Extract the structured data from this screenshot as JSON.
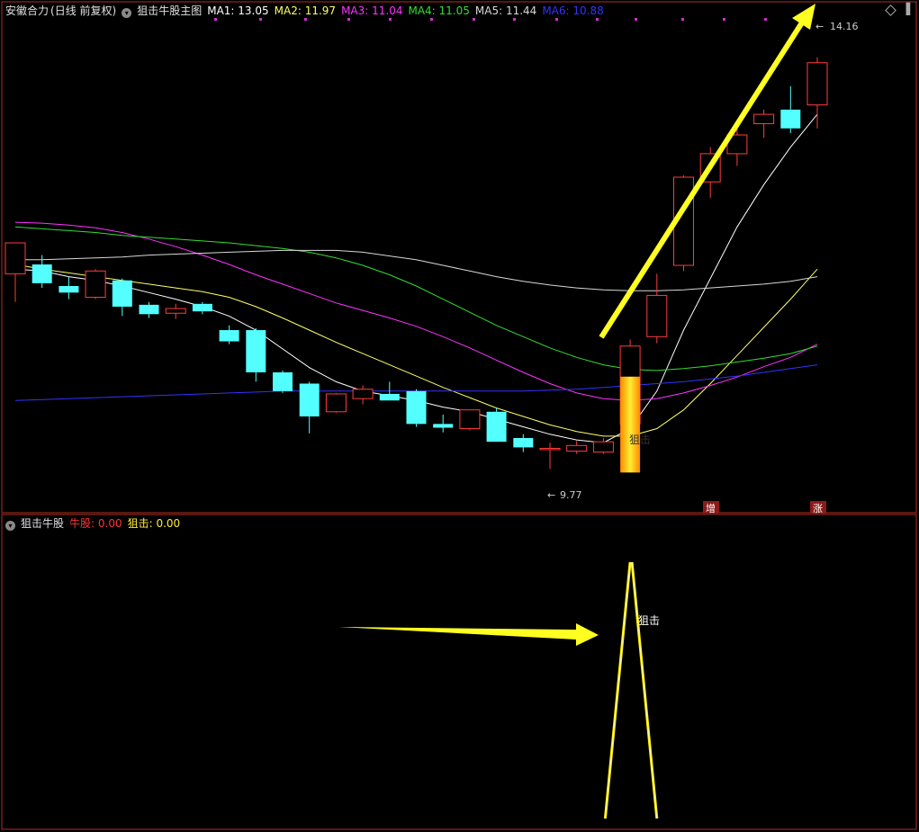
{
  "colors": {
    "background": "#000000",
    "frame": "#c0392b",
    "up_candle": "#ff3c3c",
    "down_candle": "#54ffff",
    "ma1": "#ffffff",
    "ma2": "#ffff66",
    "ma3": "#ff33ff",
    "ma4": "#33dd33",
    "ma5": "#d8d8d8",
    "ma6": "#3333ff",
    "signal": "#ffee00",
    "arrow": "#ffff22",
    "marker": "#cc33cc"
  },
  "header": {
    "stock_name": "安徽合力",
    "period": "(日线 前复权)",
    "indicator_name": "狙击牛股主图",
    "ma_labels": [
      {
        "label": "MA1: 13.05",
        "color_key": "ma1"
      },
      {
        "label": "MA2: 11.97",
        "color_key": "ma2"
      },
      {
        "label": "MA3: 11.04",
        "color_key": "ma3"
      },
      {
        "label": "MA4: 11.05",
        "color_key": "ma4"
      },
      {
        "label": "MA5: 11.44",
        "color_key": "ma5"
      },
      {
        "label": "MA6: 10.88",
        "color_key": "ma6"
      }
    ]
  },
  "sub_header": {
    "indicator_name": "狙击牛股",
    "niugu_label": "牛股: 0.00",
    "juji_label": "狙击: 0.00"
  },
  "annotations": {
    "high_label": "14.16",
    "low_label": "9.77",
    "signal_text_main": "狙击",
    "signal_text_sub": "狙击",
    "badge_zeng": "增",
    "badge_zhang": "涨"
  },
  "chart_data": [
    {
      "type": "candlestick",
      "title": "狙击牛股主图",
      "ylim": [
        9.4,
        14.5
      ],
      "candles": [
        {
          "o": 11.85,
          "h": 12.05,
          "l": 11.55,
          "c": 12.18
        },
        {
          "o": 11.95,
          "h": 12.05,
          "l": 11.7,
          "c": 11.75
        },
        {
          "o": 11.72,
          "h": 11.82,
          "l": 11.58,
          "c": 11.65
        },
        {
          "o": 11.6,
          "h": 11.9,
          "l": 11.58,
          "c": 11.88
        },
        {
          "o": 11.78,
          "h": 11.8,
          "l": 11.4,
          "c": 11.5
        },
        {
          "o": 11.52,
          "h": 11.55,
          "l": 11.38,
          "c": 11.42
        },
        {
          "o": 11.43,
          "h": 11.53,
          "l": 11.37,
          "c": 11.48
        },
        {
          "o": 11.53,
          "h": 11.55,
          "l": 11.42,
          "c": 11.45
        },
        {
          "o": 11.25,
          "h": 11.3,
          "l": 11.1,
          "c": 11.13
        },
        {
          "o": 11.25,
          "h": 11.27,
          "l": 10.7,
          "c": 10.8
        },
        {
          "o": 10.8,
          "h": 10.82,
          "l": 10.58,
          "c": 10.6
        },
        {
          "o": 10.68,
          "h": 10.7,
          "l": 10.15,
          "c": 10.33
        },
        {
          "o": 10.38,
          "h": 10.58,
          "l": 10.37,
          "c": 10.57
        },
        {
          "o": 10.52,
          "h": 10.66,
          "l": 10.46,
          "c": 10.62
        },
        {
          "o": 10.57,
          "h": 10.7,
          "l": 10.5,
          "c": 10.5
        },
        {
          "o": 10.6,
          "h": 10.62,
          "l": 10.22,
          "c": 10.25
        },
        {
          "o": 10.25,
          "h": 10.35,
          "l": 10.16,
          "c": 10.21
        },
        {
          "o": 10.2,
          "h": 10.4,
          "l": 10.18,
          "c": 10.4
        },
        {
          "o": 10.38,
          "h": 10.42,
          "l": 10.06,
          "c": 10.06
        },
        {
          "o": 10.1,
          "h": 10.14,
          "l": 9.95,
          "c": 10.0
        },
        {
          "o": 9.99,
          "h": 10.05,
          "l": 9.77,
          "c": 9.99
        },
        {
          "o": 9.96,
          "h": 10.07,
          "l": 9.93,
          "c": 10.02
        },
        {
          "o": 9.95,
          "h": 10.1,
          "l": 9.93,
          "c": 10.06
        },
        {
          "o": 10.25,
          "h": 11.15,
          "l": 10.06,
          "c": 11.08
        },
        {
          "o": 11.18,
          "h": 11.85,
          "l": 11.11,
          "c": 11.62
        },
        {
          "o": 11.94,
          "h": 12.9,
          "l": 11.88,
          "c": 12.88
        },
        {
          "o": 12.83,
          "h": 13.2,
          "l": 12.66,
          "c": 13.13
        },
        {
          "o": 13.13,
          "h": 13.4,
          "l": 13.0,
          "c": 13.33
        },
        {
          "o": 13.45,
          "h": 13.6,
          "l": 13.3,
          "c": 13.55
        },
        {
          "o": 13.6,
          "h": 13.85,
          "l": 13.35,
          "c": 13.4
        },
        {
          "o": 13.65,
          "h": 14.16,
          "l": 13.4,
          "c": 14.1
        }
      ],
      "signal_candle_index": 23,
      "ma_series": [
        {
          "name": "MA1",
          "color_key": "ma1",
          "values": [
            11.9,
            11.88,
            11.82,
            11.78,
            11.72,
            11.65,
            11.58,
            11.5,
            11.4,
            11.25,
            11.05,
            10.85,
            10.7,
            10.6,
            10.55,
            10.5,
            10.43,
            10.38,
            10.3,
            10.22,
            10.14,
            10.08,
            10.05,
            10.2,
            10.6,
            11.25,
            11.8,
            12.35,
            12.8,
            13.2,
            13.55
          ]
        },
        {
          "name": "MA2",
          "color_key": "ma2",
          "values": [
            11.95,
            11.9,
            11.86,
            11.82,
            11.78,
            11.74,
            11.7,
            11.66,
            11.6,
            11.5,
            11.38,
            11.25,
            11.12,
            11.0,
            10.88,
            10.76,
            10.64,
            10.53,
            10.42,
            10.33,
            10.24,
            10.17,
            10.12,
            10.12,
            10.2,
            10.4,
            10.68,
            10.98,
            11.28,
            11.58,
            11.9
          ]
        },
        {
          "name": "MA3",
          "color_key": "ma3",
          "values": [
            12.4,
            12.39,
            12.37,
            12.34,
            12.29,
            12.22,
            12.14,
            12.05,
            11.95,
            11.84,
            11.74,
            11.64,
            11.54,
            11.46,
            11.38,
            11.29,
            11.18,
            11.06,
            10.93,
            10.8,
            10.68,
            10.58,
            10.52,
            10.5,
            10.52,
            10.58,
            10.66,
            10.75,
            10.86,
            10.96,
            11.1
          ]
        },
        {
          "name": "MA4",
          "color_key": "ma4",
          "values": [
            12.35,
            12.33,
            12.31,
            12.29,
            12.26,
            12.24,
            12.22,
            12.2,
            12.18,
            12.15,
            12.12,
            12.08,
            12.02,
            11.94,
            11.84,
            11.72,
            11.58,
            11.44,
            11.3,
            11.18,
            11.06,
            10.96,
            10.88,
            10.83,
            10.82,
            10.84,
            10.87,
            10.91,
            10.95,
            11.0,
            11.08
          ]
        },
        {
          "name": "MA5",
          "color_key": "ma5",
          "values": [
            12.0,
            12.0,
            12.01,
            12.02,
            12.03,
            12.05,
            12.06,
            12.07,
            12.08,
            12.09,
            12.1,
            12.1,
            12.1,
            12.08,
            12.04,
            12.0,
            11.94,
            11.88,
            11.82,
            11.77,
            11.73,
            11.7,
            11.68,
            11.67,
            11.67,
            11.68,
            11.7,
            11.72,
            11.74,
            11.77,
            11.82
          ]
        },
        {
          "name": "MA6",
          "color_key": "ma6",
          "values": [
            10.5,
            10.51,
            10.52,
            10.53,
            10.54,
            10.55,
            10.56,
            10.57,
            10.58,
            10.59,
            10.6,
            10.6,
            10.6,
            10.6,
            10.6,
            10.6,
            10.6,
            10.6,
            10.6,
            10.6,
            10.61,
            10.62,
            10.64,
            10.66,
            10.68,
            10.7,
            10.73,
            10.76,
            10.8,
            10.84,
            10.88
          ]
        }
      ]
    },
    {
      "type": "line",
      "title": "狙击牛股",
      "ylim": [
        0,
        1
      ],
      "series": [
        {
          "name": "狙击",
          "color_key": "signal",
          "values": [
            0,
            0,
            0,
            0,
            0,
            0,
            0,
            0,
            0,
            0,
            0,
            0,
            0,
            0,
            0,
            0,
            0,
            0,
            0,
            0,
            0,
            0,
            0,
            1,
            0,
            0,
            0,
            0,
            0,
            0,
            0
          ]
        }
      ]
    }
  ]
}
